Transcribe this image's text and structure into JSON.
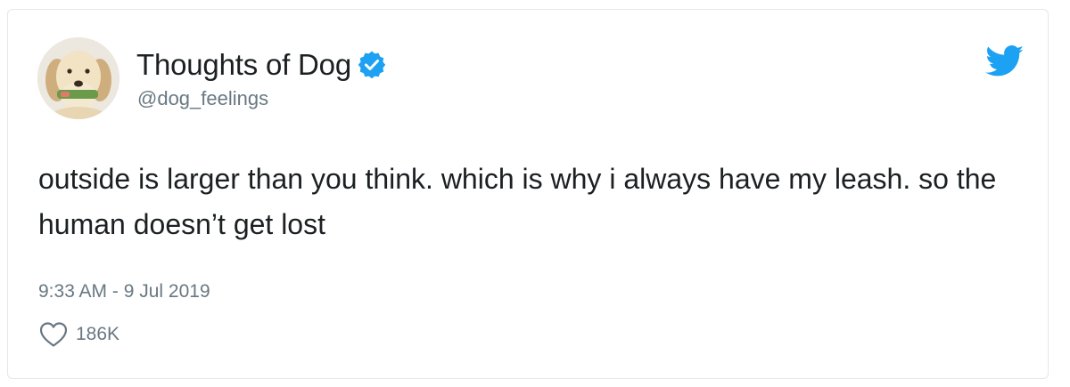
{
  "tweet": {
    "author": {
      "display_name": "Thoughts of Dog",
      "handle": "@dog_feelings",
      "verified": true,
      "avatar": "dog-holding-toy-avatar"
    },
    "text": "outside is larger than you think. which is why i always have my leash. so the human doesn’t get lost",
    "timestamp": "9:33 AM - 9 Jul 2019",
    "likes": "186K"
  },
  "icons": {
    "verified": "verified-badge-icon",
    "brand": "twitter-bird-icon",
    "like": "heart-icon"
  },
  "colors": {
    "brand_blue": "#1da1f2",
    "text": "#1c2022",
    "muted": "#697882"
  }
}
